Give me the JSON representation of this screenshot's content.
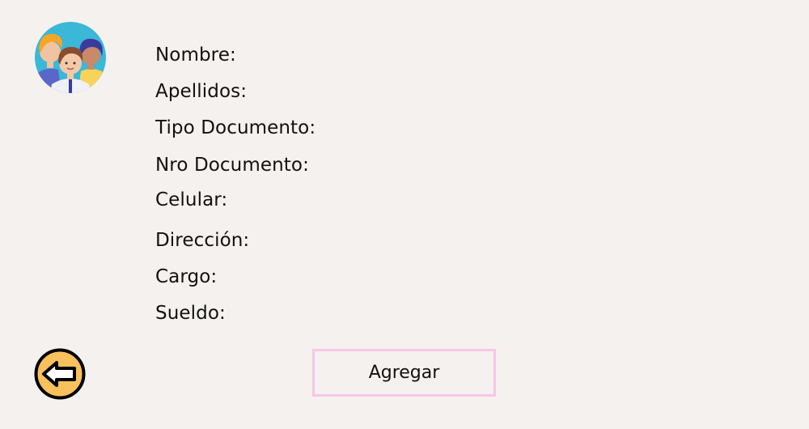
{
  "avatar": {
    "icon": "team-people-icon"
  },
  "form": {
    "fields": [
      {
        "label": "Nombre:"
      },
      {
        "label": "Apellidos:"
      },
      {
        "label": "Tipo Documento:"
      },
      {
        "label": "Nro Documento:"
      },
      {
        "label": "Celular:"
      },
      {
        "label": "Dirección:"
      },
      {
        "label": "Cargo:"
      },
      {
        "label": "Sueldo:"
      }
    ]
  },
  "actions": {
    "back_icon": "arrow-left-icon",
    "add_label": "Agregar"
  },
  "colors": {
    "background": "#f5f1ee",
    "button_border": "#f7c6e8",
    "back_fill": "#f8c15c"
  }
}
